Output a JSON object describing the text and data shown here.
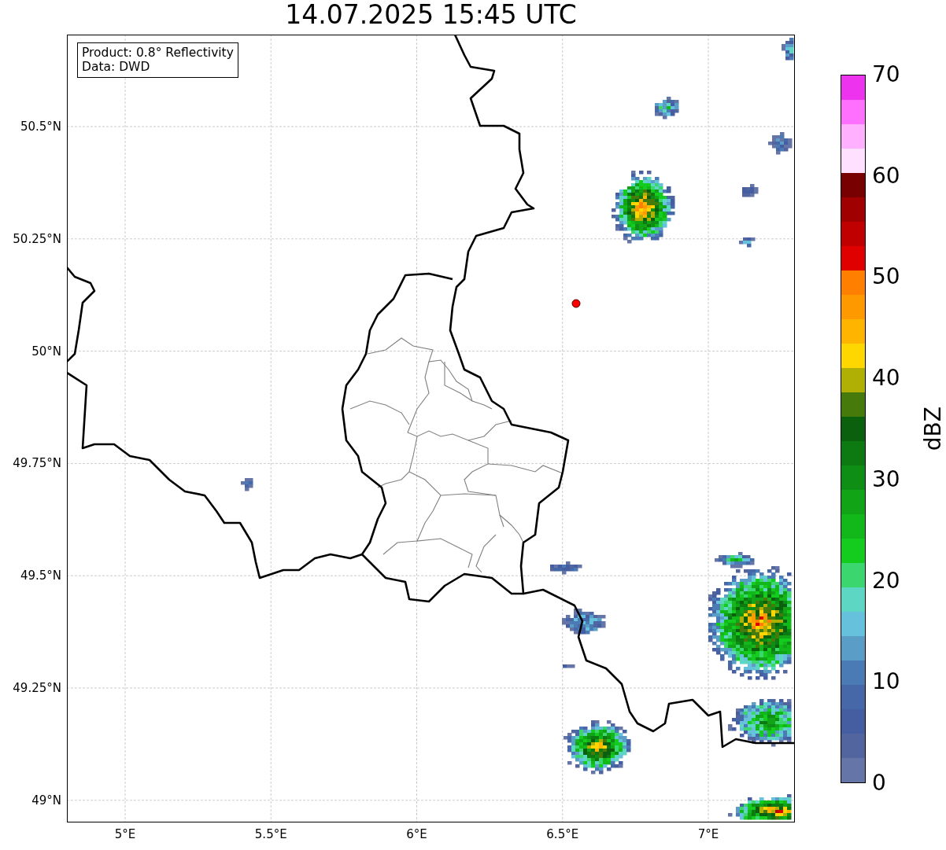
{
  "title": "14.07.2025 15:45 UTC",
  "legend": {
    "lines": [
      "Product: 0.8° Reflectivity",
      "Data: DWD"
    ]
  },
  "map": {
    "y_ticks": [
      "50.5°N",
      "50.25°N",
      "50°N",
      "49.75°N",
      "49.5°N",
      "49.25°N",
      "49°N"
    ],
    "x_ticks": [
      "5°E",
      "5.5°E",
      "6°E",
      "6.5°E",
      "7°E"
    ]
  },
  "colorbar": {
    "label": "dBZ",
    "ticks": [
      "70",
      "60",
      "50",
      "40",
      "30",
      "20",
      "10",
      "0"
    ],
    "bins": [
      {
        "color": "#ee33ee"
      },
      {
        "color": "#ff70ff"
      },
      {
        "color": "#ffb0ff"
      },
      {
        "color": "#ffe0ff"
      },
      {
        "color": "#780000"
      },
      {
        "color": "#a00000"
      },
      {
        "color": "#c00000"
      },
      {
        "color": "#e00000"
      },
      {
        "color": "#ff7f00"
      },
      {
        "color": "#ff9900"
      },
      {
        "color": "#ffb400"
      },
      {
        "color": "#ffd700"
      },
      {
        "color": "#b0b004"
      },
      {
        "color": "#467a0a"
      },
      {
        "color": "#0a600c"
      },
      {
        "color": "#0c7a10"
      },
      {
        "color": "#0e8e14"
      },
      {
        "color": "#10a416"
      },
      {
        "color": "#12b81a"
      },
      {
        "color": "#14cc1e"
      },
      {
        "color": "#3cd66e"
      },
      {
        "color": "#5ed6c4"
      },
      {
        "color": "#66c2dc"
      },
      {
        "color": "#5a9ec8"
      },
      {
        "color": "#4a7bb4"
      },
      {
        "color": "#4668a8"
      },
      {
        "color": "#455ea2"
      },
      {
        "color": "#52659e"
      },
      {
        "color": "#6675a8"
      }
    ]
  }
}
